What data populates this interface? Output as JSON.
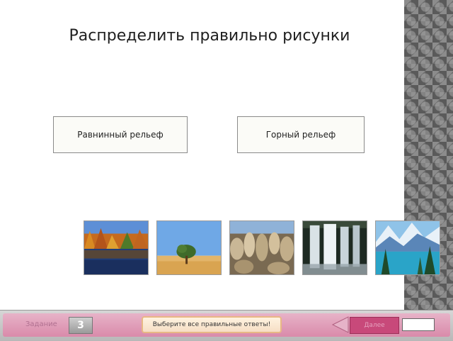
{
  "title": "Распределить правильно рисунки",
  "categories": {
    "plain": "Равнинный рельеф",
    "mountain": "Горный рельеф"
  },
  "images": [
    {
      "name": "autumn-lake-image"
    },
    {
      "name": "desert-tree-image"
    },
    {
      "name": "rock-formations-image"
    },
    {
      "name": "waterfall-image"
    },
    {
      "name": "snowy-mountain-lake-image"
    }
  ],
  "footer": {
    "task_label": "Задание",
    "task_number": "3",
    "hint": "Выберите все правильные ответы!",
    "check_label": "Далее"
  },
  "colors": {
    "footer_pink": "#d98aaa",
    "check_button": "#c8497a",
    "hint_border": "#e8b884"
  }
}
